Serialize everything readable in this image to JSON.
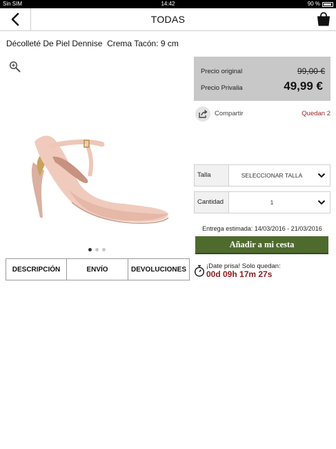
{
  "status_bar": {
    "carrier": "Sin SIM",
    "time": "14:42",
    "battery": "90 %",
    "battery_level": 0.9
  },
  "nav": {
    "title": "TODAS",
    "back_icon": "chevron-left-icon",
    "cart_icon": "shopping-bag-icon"
  },
  "product": {
    "title": "Décolleté De Piel Dennise  Crema Tacón: 9 cm",
    "image_icon": "shoe-image",
    "carousel": {
      "count": 3,
      "active": 1
    }
  },
  "tabs": [
    {
      "label": "DESCRIPCIÓN"
    },
    {
      "label": "ENVÍO"
    },
    {
      "label": "DEVOLUCIONES"
    }
  ],
  "pricing": {
    "original_label": "Precio original",
    "original_value": "99,00 €",
    "privalia_label": "Precio Privalia",
    "privalia_value": "49,99 €"
  },
  "share": {
    "label": "Compartir",
    "remaining": "Quedan 2"
  },
  "size": {
    "label": "Talla",
    "value": "SELECCIONAR TALLA"
  },
  "quantity": {
    "label": "Cantidad",
    "value": "1"
  },
  "delivery": "Entrega estimada: 14/03/2016 - 21/03/2016",
  "add_to_cart": "Añadir a mi cesta",
  "countdown": {
    "hurry_text": "¡Date prisa! Solo quedan:",
    "time_left": "00d 09h 17m 27s"
  },
  "colors": {
    "accent_green": "#4e6b2d",
    "accent_red": "#8b1c1c",
    "price_box": "#c8c8c8"
  }
}
